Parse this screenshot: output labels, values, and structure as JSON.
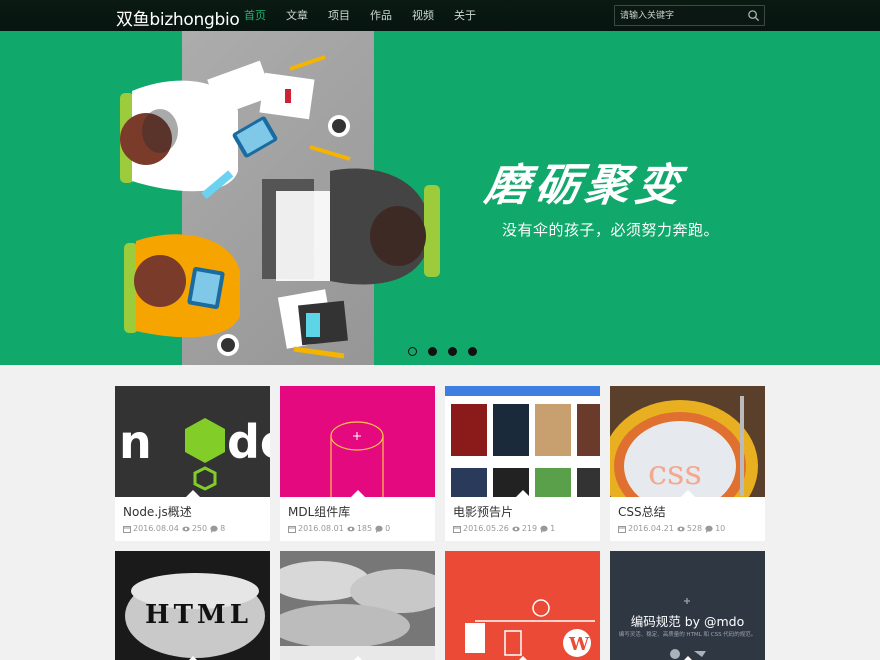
{
  "nav": {
    "brand": "双鱼bizhongbio",
    "items": [
      {
        "label": "首页",
        "active": true
      },
      {
        "label": "文章",
        "active": false
      },
      {
        "label": "项目",
        "active": false
      },
      {
        "label": "作品",
        "active": false
      },
      {
        "label": "视频",
        "active": false
      },
      {
        "label": "关于",
        "active": false
      }
    ],
    "search_placeholder": "请输入关键字"
  },
  "banner": {
    "headline": "磨砺聚变",
    "subtitle": "没有伞的孩子，必须努力奔跑。",
    "slide_count": 4,
    "active_slide": 1
  },
  "cards": [
    {
      "title": "Node.js概述",
      "date": "2016.08.04",
      "views": "250",
      "comments": "8"
    },
    {
      "title": "MDL组件库",
      "date": "2016.08.01",
      "views": "185",
      "comments": "0"
    },
    {
      "title": "电影预告片",
      "date": "2016.05.26",
      "views": "219",
      "comments": "1"
    },
    {
      "title": "CSS总结",
      "date": "2016.04.21",
      "views": "528",
      "comments": "10"
    }
  ],
  "row2": {
    "html_text": "HTML",
    "mdo_title": "编码规范 by @mdo",
    "mdo_sub": "编写灵活、稳定、高质量的 HTML 和 CSS 代码的规范。"
  },
  "colors": {
    "accent": "#1fb56f",
    "banner": "#11a86b",
    "nav": "#0a1a12"
  }
}
